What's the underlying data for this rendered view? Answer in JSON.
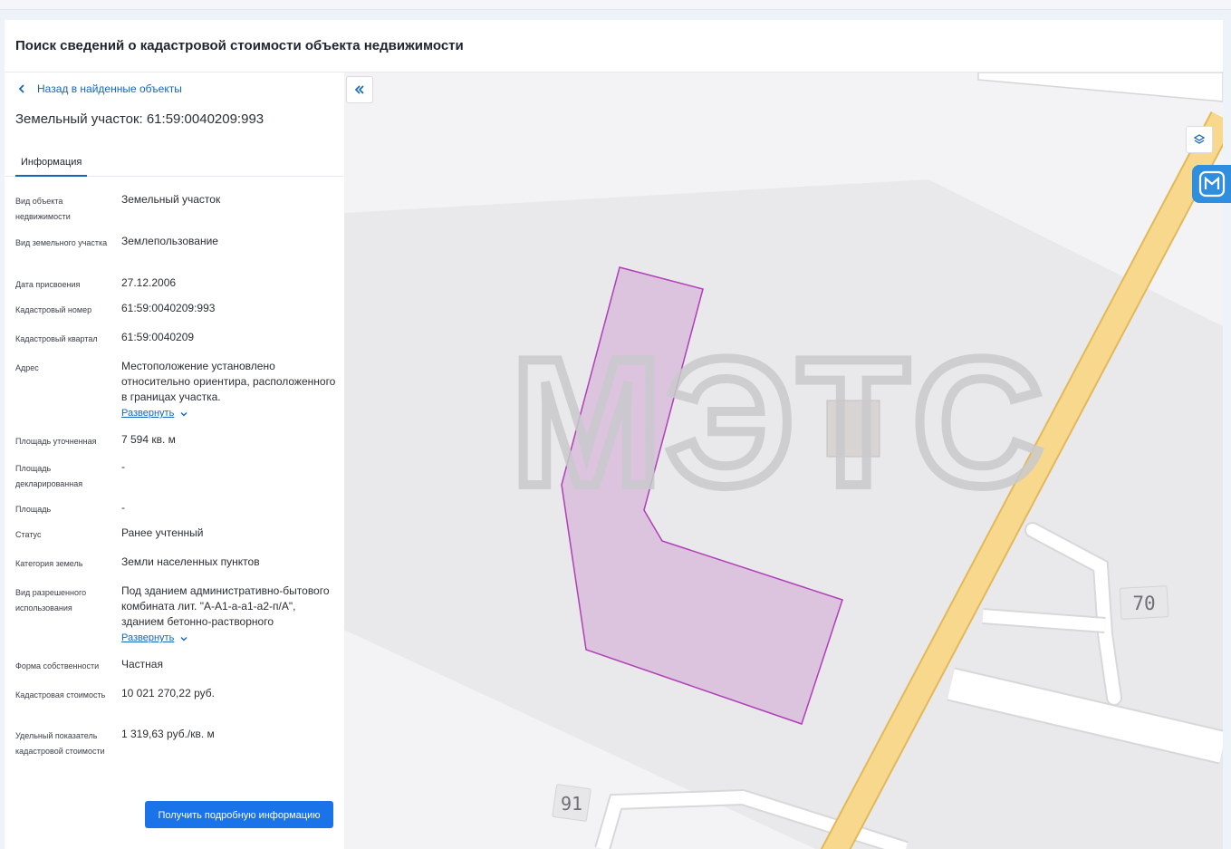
{
  "page": {
    "title": "Поиск сведений о кадастровой стоимости объекта недвижимости"
  },
  "panel": {
    "back_label": "Назад в найденные объекты",
    "object_title": "Земельный участок: 61:59:0040209:993",
    "tabs": [
      {
        "label": "Информация",
        "active": true
      }
    ],
    "expand_label": "Развернуть",
    "fields": {
      "object_type": {
        "label": "Вид объекта недвижимости",
        "value": "Земельный участок"
      },
      "land_type": {
        "label": "Вид земельного участка",
        "value": "Землепользование"
      },
      "assign_date": {
        "label": "Дата присвоения",
        "value": "27.12.2006"
      },
      "cadastral_number": {
        "label": "Кадастровый номер",
        "value": "61:59:0040209:993"
      },
      "cadastral_quarter": {
        "label": "Кадастровый квартал",
        "value": "61:59:0040209"
      },
      "address": {
        "label": "Адрес",
        "value": "Местоположение установлено относительно ориентира, расположенного в границах участка."
      },
      "area_specified": {
        "label": "Площадь уточненная",
        "value": "7 594 кв. м"
      },
      "area_declared": {
        "label": "Площадь декларированная",
        "value": "-"
      },
      "area": {
        "label": "Площадь",
        "value": "-"
      },
      "status": {
        "label": "Статус",
        "value": "Ранее учтенный"
      },
      "land_category": {
        "label": "Категория земель",
        "value": "Земли населенных пунктов"
      },
      "permitted_use": {
        "label": "Вид разрешенного использования",
        "value": "Под зданием административно-бытового комбината лит. \"А-А1-а-а1-а2-п/А\", зданием бетонно-растворного"
      },
      "ownership": {
        "label": "Форма собственности",
        "value": "Частная"
      },
      "cadastral_value": {
        "label": "Кадастровая стоимость",
        "value": "10 021 270,22 руб."
      },
      "specific_value": {
        "label": "Удельный показатель кадастровой стоимости",
        "value": "1 319,63 руб./кв. м"
      }
    },
    "details_button": "Получить подробную информацию"
  },
  "map": {
    "watermark": "МЭТС",
    "house_numbers": [
      "70",
      "91"
    ],
    "parcel_fill": "#dcc3de",
    "parcel_stroke": "#b03fb8",
    "road_color": "#f7d88c"
  },
  "icons": {
    "back": "chevron-left-icon",
    "expand": "chevron-down-icon",
    "collapse": "double-chevron-left-icon",
    "layers": "layers-icon",
    "help": "help-chat-icon"
  },
  "colors": {
    "accent": "#1a73e8",
    "link": "#1565c0"
  }
}
